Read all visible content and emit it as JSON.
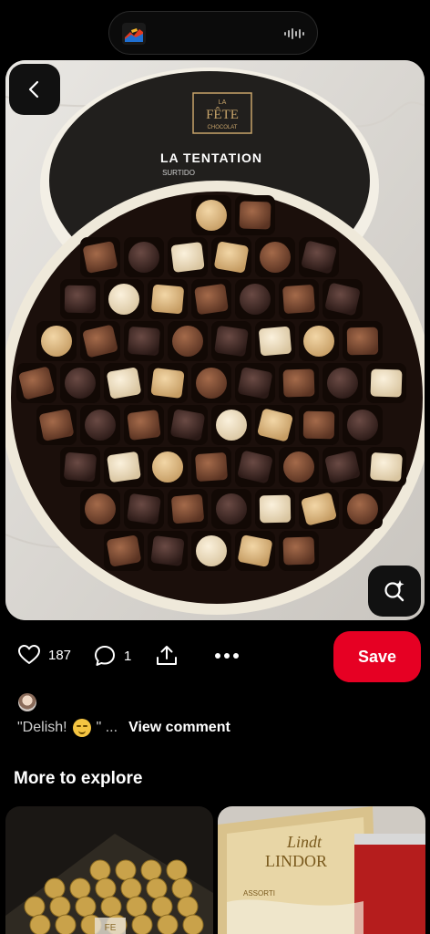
{
  "status_bar": {
    "app_icon": "app-thumbnail-icon",
    "activity": "audio-waveform-icon"
  },
  "pin": {
    "image_alt": "Round box of assorted chocolates",
    "lid_brand_top": "LA",
    "lid_brand": "FÊTE",
    "lid_brand_sub": "CHOCOLAT",
    "lid_title": "LA TENTATION",
    "lid_subtitle": "SURTIDO"
  },
  "actions": {
    "like_count": "187",
    "comment_count": "1",
    "save_label": "Save"
  },
  "comment": {
    "text_start": "\"Delish!",
    "text_end": "\" ...",
    "view_label": "View comment"
  },
  "explore": {
    "title": "More to explore",
    "thumb_right_brand": "Lindt",
    "thumb_right_product": "LINDOR",
    "thumb_right_tag": "ASSORTI",
    "thumb_left_mark": "FE"
  },
  "colors": {
    "save_red": "#e60023",
    "background": "#000000"
  }
}
